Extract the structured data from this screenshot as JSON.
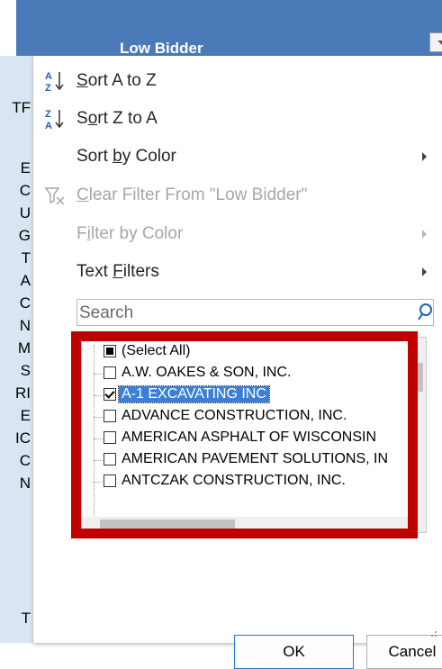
{
  "column_header": {
    "title": "Low Bidder"
  },
  "sheet_fragments": [
    "TF",
    "E",
    "C",
    "U",
    "G",
    "T",
    "A",
    "C",
    "N",
    "M",
    "S",
    "RI",
    "E",
    "IC",
    "C",
    "N",
    "T"
  ],
  "menu": {
    "sort_az": {
      "prefix": "",
      "mnemonic": "S",
      "suffix": "ort A to Z"
    },
    "sort_za": {
      "prefix": "S",
      "mnemonic": "o",
      "suffix": "rt Z to A"
    },
    "sort_color": {
      "prefix": "Sort ",
      "mnemonic": "b",
      "suffix": "y Color"
    },
    "clear_filter": {
      "prefix": "",
      "mnemonic": "C",
      "suffix": "lear Filter From \"Low Bidder\""
    },
    "filter_color": {
      "prefix": "F",
      "mnemonic": "i",
      "suffix": "lter by Color"
    },
    "text_filters": {
      "prefix": "Text ",
      "mnemonic": "F",
      "suffix": "ilters"
    }
  },
  "search": {
    "placeholder": "Search"
  },
  "filter_list": [
    {
      "label": "(Select All)",
      "state": "indeterminate"
    },
    {
      "label": "A.W. OAKES & SON, INC.",
      "state": "unchecked"
    },
    {
      "label": "A-1 EXCAVATING INC",
      "state": "checked"
    },
    {
      "label": "ADVANCE CONSTRUCTION, INC.",
      "state": "unchecked"
    },
    {
      "label": "AMERICAN ASPHALT OF WISCONSIN",
      "state": "unchecked"
    },
    {
      "label": "AMERICAN PAVEMENT SOLUTIONS, IN",
      "state": "unchecked"
    },
    {
      "label": "ANTCZAK CONSTRUCTION, INC.",
      "state": "unchecked"
    }
  ],
  "buttons": {
    "ok": "OK",
    "cancel": "Cancel"
  },
  "colors": {
    "header_blue": "#4a7ab8",
    "highlight_red": "#c00000",
    "selection_blue": "#3b7fd6"
  }
}
